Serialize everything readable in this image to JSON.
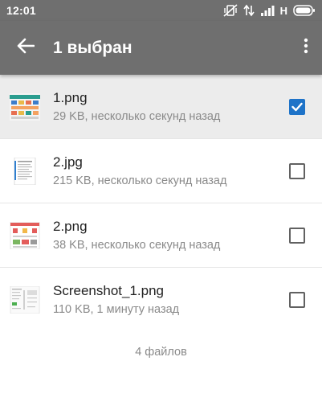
{
  "status_bar": {
    "time": "12:01",
    "network": "H",
    "icons": [
      "vibrate-off-icon",
      "data-transfer-icon",
      "signal-icon",
      "battery-icon"
    ]
  },
  "app_bar": {
    "title": "1 выбран",
    "back_icon": "arrow-back-icon",
    "menu_icon": "more-vert-icon",
    "color": "#6f6f6f"
  },
  "files": [
    {
      "name": "1.png",
      "meta": "29 KB, несколько секунд назад",
      "selected": true
    },
    {
      "name": "2.jpg",
      "meta": "215 KB, несколько секунд назад",
      "selected": false
    },
    {
      "name": "2.png",
      "meta": "38 KB, несколько секунд назад",
      "selected": false
    },
    {
      "name": "Screenshot_1.png",
      "meta": "110 KB, 1 минуту назад",
      "selected": false
    }
  ],
  "footer": {
    "count": "4 файлов"
  },
  "colors": {
    "accent": "#1e73c8",
    "selected_row": "#ececec"
  }
}
